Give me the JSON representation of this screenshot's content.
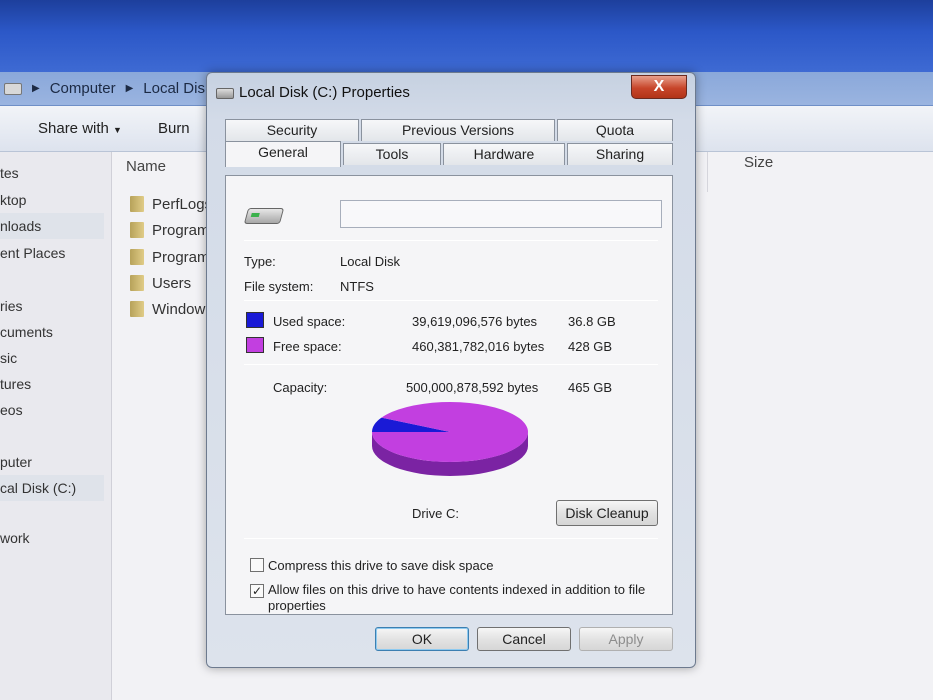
{
  "explorer": {
    "breadcrumbs": [
      "Computer",
      "Local Disk"
    ],
    "toolbar": {
      "share_with": "Share with",
      "burn": "Burn"
    },
    "nav_items": [
      "tes",
      "ktop",
      "nloads",
      "ent Places",
      "ries",
      "cuments",
      "sic",
      "tures",
      "eos",
      "puter",
      "cal Disk (C:)",
      "work"
    ],
    "columns": {
      "name": "Name",
      "size": "Size"
    },
    "files": [
      "PerfLogs",
      "Program",
      "Program",
      "Users",
      "Window"
    ]
  },
  "dialog": {
    "title": "Local Disk (C:) Properties",
    "close_label": "X",
    "tabs_row1": [
      "Security",
      "Previous Versions",
      "Quota"
    ],
    "tabs_row2": [
      "General",
      "Tools",
      "Hardware",
      "Sharing"
    ],
    "active_tab": "General",
    "label_value": "",
    "type_label": "Type:",
    "type_value": "Local Disk",
    "fs_label": "File system:",
    "fs_value": "NTFS",
    "used": {
      "label": "Used space:",
      "bytes": "39,619,096,576 bytes",
      "size": "36.8 GB",
      "color": "#1a1ad6"
    },
    "free": {
      "label": "Free space:",
      "bytes": "460,381,782,016 bytes",
      "size": "428 GB",
      "color": "#c23fe0"
    },
    "capacity": {
      "label": "Capacity:",
      "bytes": "500,000,878,592 bytes",
      "size": "465 GB"
    },
    "drive_label": "Drive C:",
    "disk_cleanup": "Disk Cleanup",
    "compress": {
      "label": "Compress this drive to save disk space",
      "checked": false
    },
    "index": {
      "label_line1": "Allow files on this drive to have contents indexed in addition to file",
      "label_line2": "properties",
      "checked": true,
      "check_glyph": "✓"
    },
    "buttons": {
      "ok": "OK",
      "cancel": "Cancel",
      "apply": "Apply"
    }
  },
  "chart_data": {
    "type": "pie",
    "categories": [
      "Used space",
      "Free space"
    ],
    "values": [
      39619096576,
      460381782016
    ],
    "colors": [
      "#1a1ad6",
      "#c23fe0"
    ]
  }
}
